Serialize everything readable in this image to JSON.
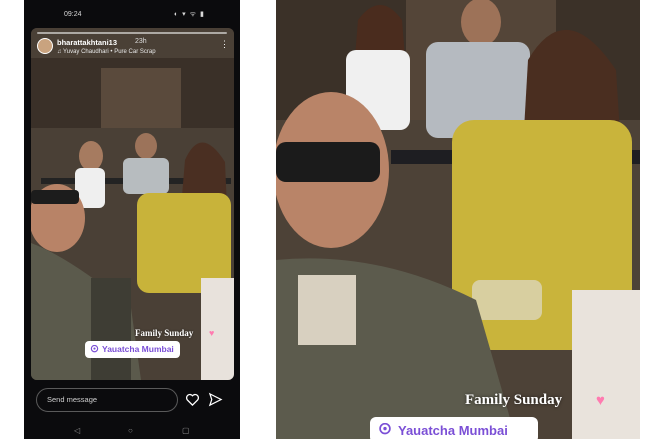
{
  "status_bar": {
    "time": "09:24",
    "icons": "◐ ▾ ᯤ ▮"
  },
  "story": {
    "username": "bharattakhtani13",
    "time_ago": "23h",
    "music": "♫ Yuvay Chaudhari • Pure Car Scrap",
    "caption": "Family Sunday",
    "location": "Yauatcha Mumbai"
  },
  "reply": {
    "placeholder": "Send message"
  },
  "nav": {
    "back": "◁",
    "home": "○",
    "recent": "▢"
  },
  "zoomed": {
    "caption": "Family Sunday",
    "location": "Yauatcha Mumbai"
  },
  "colors": {
    "location_text": "#7b4fd6",
    "heart": "#ff7bb0",
    "shirt_yellow": "#c8b33a"
  }
}
